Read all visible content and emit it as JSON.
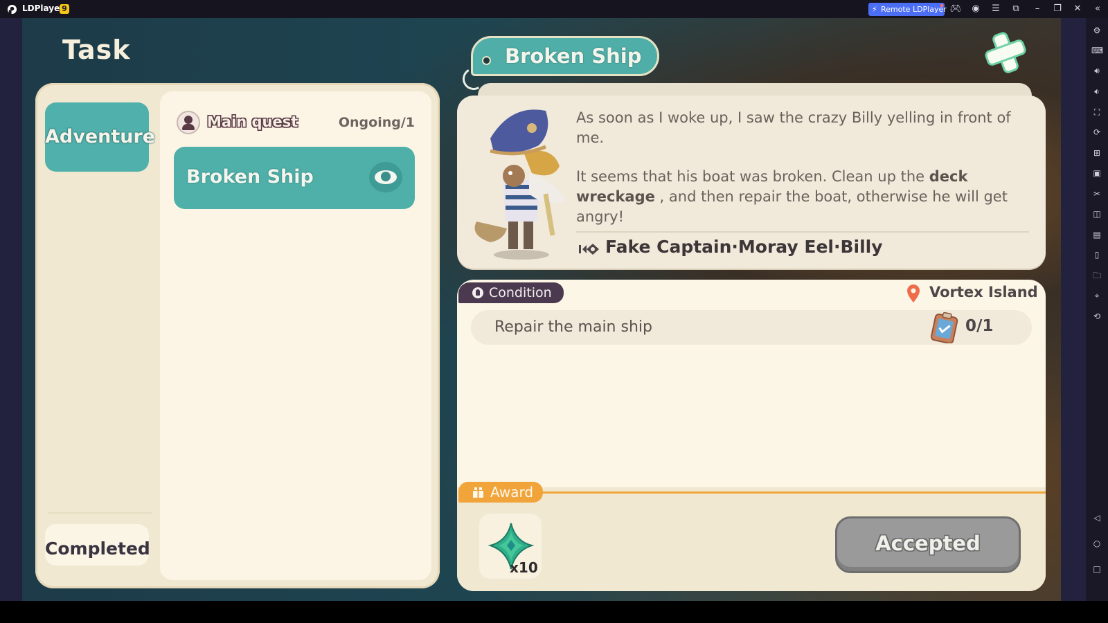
{
  "window": {
    "app_name": "LDPlayer",
    "version_badge": "9",
    "remote_button_label": "Remote LDPlayer",
    "titlebar_icons": [
      "gamepad-icon",
      "account-icon",
      "menu-icon",
      "screenshot-window-icon",
      "minimize-icon",
      "restore-icon",
      "close-icon",
      "collapse-sidebar-icon"
    ]
  },
  "sidebar": {
    "tools": [
      "settings-icon",
      "keyboard-mapping-icon",
      "volume-up-icon",
      "volume-down-icon",
      "fullscreen-icon",
      "sync-icon",
      "add-apk-icon",
      "record-icon",
      "scissors-icon",
      "multi-instance-icon",
      "script-icon",
      "shake-icon",
      "folder-icon",
      "location-icon",
      "rotate-icon"
    ],
    "nav": [
      "back-icon",
      "home-icon",
      "recent-apps-icon"
    ]
  },
  "game": {
    "screen_title": "Task",
    "categories": {
      "adventure": "Adventure",
      "completed": "Completed"
    },
    "quest_group": {
      "label": "Main quest",
      "count": "Ongoing/1"
    },
    "quests": [
      {
        "label": "Broken Ship",
        "selected": true
      }
    ],
    "detail": {
      "title": "Broken Ship",
      "story_p1": "As soon as I woke up, I saw the crazy Billy yelling in front of me.",
      "story_p2_before": "It seems that his boat was broken. Clean up the ",
      "story_p2_highlight": "deck wreckage",
      "story_p2_after": " , and then repair the boat, otherwise he will get angry!",
      "npc_name": "Fake Captain·Moray Eel·Billy"
    },
    "condition": {
      "tag": "Condition",
      "location": "Vortex Island",
      "items": [
        {
          "label": "Repair the main ship",
          "progress": "0/1"
        }
      ]
    },
    "award": {
      "tag": "Award",
      "items": [
        {
          "icon": "green-gem-icon",
          "quantity": "x10"
        }
      ],
      "action_button": "Accepted"
    },
    "colors": {
      "teal": "#4fafa8",
      "orange": "#f0a43a",
      "plum": "#4b3a4f"
    }
  }
}
